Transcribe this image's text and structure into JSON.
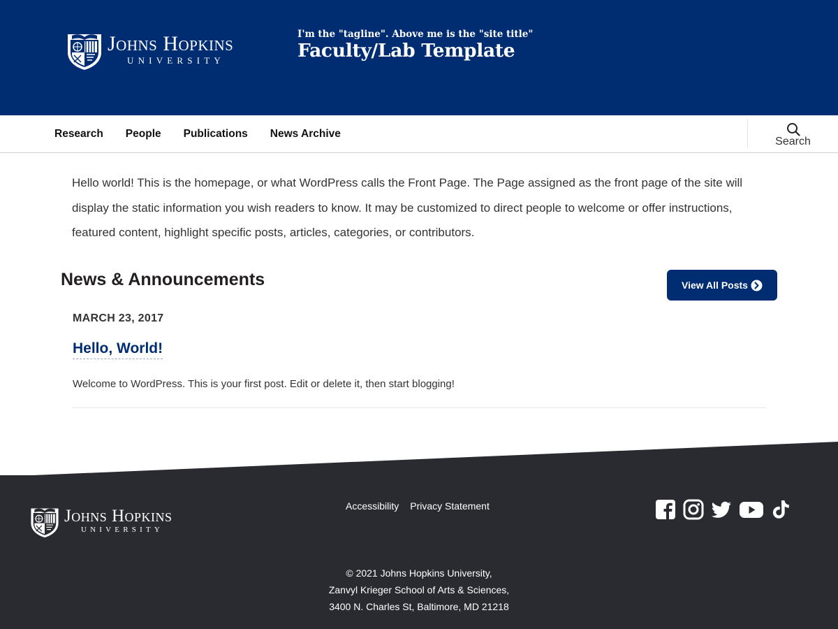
{
  "header": {
    "logo": {
      "name": "Johns Hopkins",
      "sub": "University"
    },
    "tagline": "I'm the \"tagline\". Above me is the \"site title\"",
    "site_title": "Faculty/Lab Template",
    "background": "#002d72"
  },
  "nav": {
    "items": [
      {
        "label": "Research"
      },
      {
        "label": "People"
      },
      {
        "label": "Publications"
      },
      {
        "label": "News Archive"
      }
    ],
    "search_label": "Search"
  },
  "main": {
    "intro": "Hello world! This is the homepage, or what WordPress calls the Front Page. The Page assigned as the front page of the site will display the static information you wish readers to know. It may be customized to direct people to welcome or offer instructions, featured content, highlight specific posts, articles, categories, or contributors.",
    "news_heading": "News & Announcements",
    "view_all_label": "View All Posts",
    "posts": [
      {
        "date": "MARCH 23, 2017",
        "title": "Hello, World!",
        "excerpt": "Welcome to WordPress. This is your first post. Edit or delete it, then start blogging!"
      }
    ]
  },
  "footer": {
    "logo": {
      "name": "Johns Hopkins",
      "sub": "University"
    },
    "links": [
      {
        "label": "Accessibility"
      },
      {
        "label": "Privacy Statement"
      }
    ],
    "social": [
      "facebook-icon",
      "instagram-icon",
      "twitter-icon",
      "youtube-icon",
      "tiktok-icon"
    ],
    "copyright": [
      "© 2021 Johns Hopkins University,",
      "Zanvyl Krieger School of Arts & Sciences,",
      "3400 N. Charles St, Baltimore, MD 21218"
    ],
    "background": "#2a2b30"
  }
}
